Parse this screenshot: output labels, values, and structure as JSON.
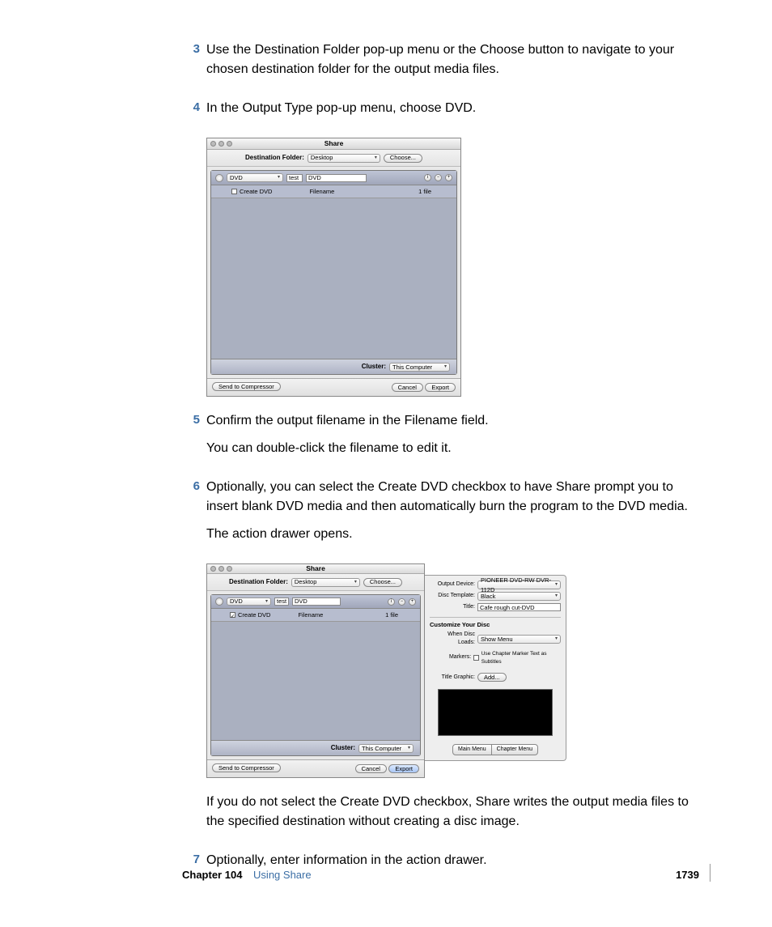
{
  "steps": {
    "s3": {
      "num": "3",
      "text": "Use the Destination Folder pop-up menu or the Choose button to navigate to your chosen destination folder for the output media files."
    },
    "s4": {
      "num": "4",
      "text": "In the Output Type pop-up menu, choose DVD."
    },
    "s5": {
      "num": "5",
      "text1": "Confirm the output filename in the Filename field.",
      "text2": "You can double-click the filename to edit it."
    },
    "s6": {
      "num": "6",
      "text1": "Optionally, you can select the Create DVD checkbox to have Share prompt you to insert blank DVD media and then automatically burn the program to the DVD media.",
      "text2": "The action drawer opens."
    },
    "post6": "If you do not select the Create DVD checkbox, Share writes the output media files to the specified destination without creating a disc image.",
    "s7": {
      "num": "7",
      "text": "Optionally, enter information in the action drawer."
    }
  },
  "share1": {
    "title": "Share",
    "dest_label": "Destination Folder:",
    "dest_value": "Desktop",
    "choose": "Choose...",
    "type_value": "DVD",
    "filename_prefix": "test",
    "filename_value": "DVD",
    "create_dvd": "Create DVD",
    "filename_col": "Filename",
    "filecount": "1 file",
    "cluster_label": "Cluster:",
    "cluster_value": "This Computer",
    "send": "Send to Compressor",
    "cancel": "Cancel",
    "export": "Export"
  },
  "share2": {
    "title": "Share",
    "dest_label": "Destination Folder:",
    "dest_value": "Desktop",
    "choose": "Choose...",
    "type_value": "DVD",
    "filename_prefix": "test",
    "filename_value": "DVD",
    "create_dvd": "Create DVD",
    "filename_col": "Filename",
    "filecount": "1 file",
    "cluster_label": "Cluster:",
    "cluster_value": "This Computer",
    "send": "Send to Compressor",
    "cancel": "Cancel",
    "export": "Export"
  },
  "drawer": {
    "output_device_label": "Output Device:",
    "output_device_value": "PIONEER DVD-RW  DVR-112D",
    "disc_template_label": "Disc Template:",
    "disc_template_value": "Black",
    "title_label": "Title:",
    "title_value": "Cafe rough cut-DVD",
    "customize": "Customize Your Disc",
    "when_disc_loads_label": "When Disc Loads:",
    "when_disc_loads_value": "Show Menu",
    "markers_label": "Markers:",
    "markers_cb": "Use Chapter Marker Text as Subtitles",
    "title_graphic_label": "Title Graphic:",
    "add": "Add...",
    "tab_main": "Main Menu",
    "tab_chapter": "Chapter Menu"
  },
  "footer": {
    "chapter_label": "Chapter 104",
    "chapter_name": "Using Share",
    "page": "1739"
  }
}
